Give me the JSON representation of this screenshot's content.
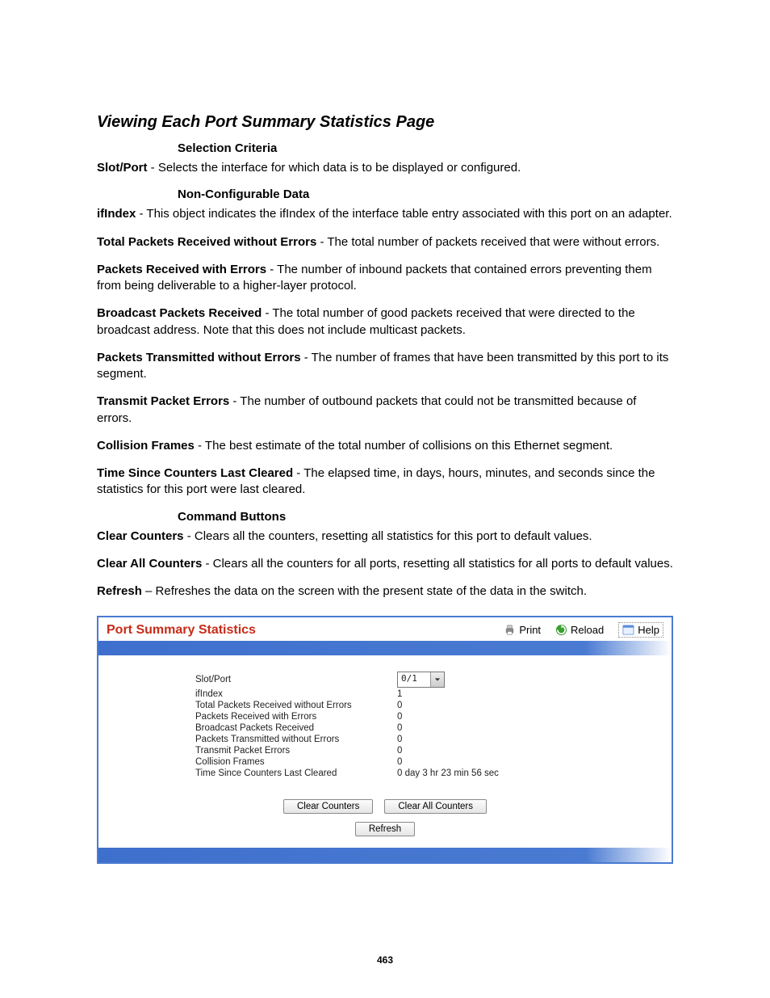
{
  "page_title": "Viewing Each Port Summary Statistics Page",
  "sections": {
    "selection_criteria": "Selection Criteria",
    "non_configurable_data": "Non-Configurable Data",
    "command_buttons": "Command Buttons"
  },
  "defs": {
    "slotport": {
      "term": "Slot/Port",
      "text": " - Selects the interface for which data is to be displayed or configured."
    },
    "ifindex": {
      "term": "ifIndex",
      "text": " - This object indicates the ifIndex of the interface table entry associated with this port on an adapter."
    },
    "tpr": {
      "term": "Total Packets Received without Errors",
      "text": " - The total number of packets received that were without errors."
    },
    "pre": {
      "term": "Packets Received with Errors",
      "text": " - The number of inbound packets that contained errors preventing them from being deliverable to a higher-layer protocol."
    },
    "bpr": {
      "term": "Broadcast Packets Received",
      "text": " - The total number of good packets received that were directed to the broadcast address. Note that this does not include multicast packets."
    },
    "pte": {
      "term": "Packets Transmitted without Errors",
      "text": " - The number of frames that have been transmitted by this port to its segment."
    },
    "tpe": {
      "term": "Transmit Packet Errors",
      "text": " - The number of outbound packets that could not be transmitted because of errors."
    },
    "cf": {
      "term": "Collision Frames",
      "text": " - The best estimate of the total number of collisions on this Ethernet segment."
    },
    "tsc": {
      "term": "Time Since Counters Last Cleared",
      "text": " - The elapsed time, in days, hours, minutes, and seconds since the statistics for this port were last cleared."
    },
    "cc": {
      "term": "Clear Counters",
      "text": " - Clears all the counters, resetting all statistics for this port to default values."
    },
    "cac": {
      "term": "Clear All Counters",
      "text": " - Clears all the counters for all ports, resetting all statistics for all ports to default values."
    },
    "ref": {
      "term": "Refresh",
      "text": " – Refreshes the data on the screen with the present state of the data in the switch."
    }
  },
  "panel": {
    "title": "Port Summary Statistics",
    "actions": {
      "print": "Print",
      "reload": "Reload",
      "help": "Help"
    },
    "slotport": {
      "label": "Slot/Port",
      "value": "0/1"
    },
    "rows": [
      {
        "label": "ifIndex",
        "value": "1"
      },
      {
        "label": "Total Packets Received without Errors",
        "value": "0"
      },
      {
        "label": "Packets Received with Errors",
        "value": "0"
      },
      {
        "label": "Broadcast Packets Received",
        "value": "0"
      },
      {
        "label": "Packets Transmitted without Errors",
        "value": "0"
      },
      {
        "label": "Transmit Packet Errors",
        "value": "0"
      },
      {
        "label": "Collision Frames",
        "value": "0"
      },
      {
        "label": "Time Since Counters Last Cleared",
        "value": "0 day 3 hr 23 min 56 sec"
      }
    ],
    "buttons": {
      "clear_counters": "Clear Counters",
      "clear_all_counters": "Clear All Counters",
      "refresh": "Refresh"
    }
  },
  "page_number": "463"
}
